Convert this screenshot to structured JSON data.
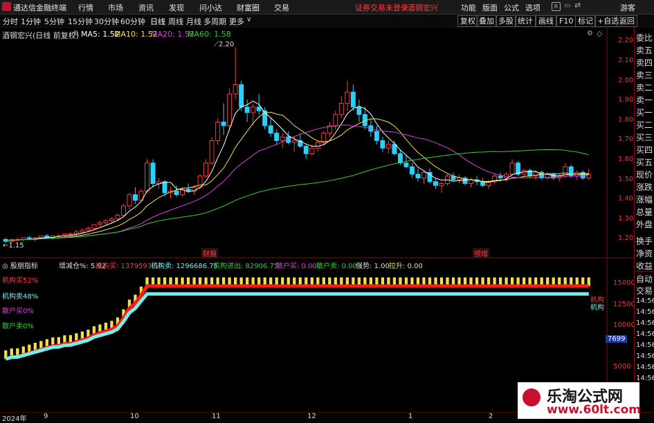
{
  "app": {
    "name": "通达信金融终端",
    "status_warning": "证券交易未登录",
    "stock_name": "酒钢宏兴",
    "guest": "游客"
  },
  "menu": [
    "行情",
    "市场",
    "资讯",
    "发现",
    "问小达",
    "财富圈",
    "交易"
  ],
  "right_menu": [
    "功能",
    "版面",
    "公式",
    "选项"
  ],
  "timeframes": [
    "分时",
    "1分钟",
    "5分钟",
    "15分钟",
    "30分钟",
    "60分钟",
    "日线",
    "周线",
    "月线",
    "多周期",
    "更多"
  ],
  "active_timeframe": "日线",
  "toolbar_right": [
    "复权",
    "叠加",
    "多股",
    "统计",
    "画线",
    "F10",
    "标记",
    "+自选",
    "返回"
  ],
  "chart_header": {
    "title": "酒钢宏兴(日线 前复权)",
    "ma5": "MA5: 1.52",
    "ma10": "MA10: 1.52",
    "ma20": "MA20: 1.52",
    "ma60": "MA60: 1.58"
  },
  "price_annotations": {
    "high": "2.20",
    "low": "1.15"
  },
  "event_labels": [
    "财报",
    "预增"
  ],
  "indicator_header": {
    "name": "股朋指标",
    "add": "增减仓%: 5.92",
    "inst_buy": "机构买: 1379593.50",
    "inst_sell": "机构卖: 1296686.75",
    "inst_net": "机构进出: 82906.75",
    "retail_buy": "散户买: 0.00",
    "retail_sell": "散户卖: 0.00",
    "strength": "强势: 1.00",
    "rise": "拉升: 0.00"
  },
  "indicator_legend": [
    "机构买52%",
    "机构卖48%",
    "散户买0%",
    "散户卖0%"
  ],
  "right_panel": [
    "委比",
    "卖五",
    "卖四",
    "卖三",
    "卖二",
    "卖一",
    "买一",
    "买二",
    "买三",
    "买四",
    "买五",
    "现价",
    "涨跌",
    "涨幅",
    "总量",
    "外盘",
    "换手",
    "净资",
    "收益",
    "自动",
    "交易"
  ],
  "time_ticks": [
    "14:56",
    "14:56",
    "14:56",
    "14:56",
    "14:56",
    "14:56",
    "14:56",
    "14:56"
  ],
  "price_axis": [
    "2.20",
    "2.10",
    "2.00",
    "1.90",
    "1.80",
    "1.70",
    "1.60",
    "1.50",
    "1.40",
    "1.30",
    "1.20"
  ],
  "indicator_axis": [
    "15000",
    "12500",
    "10000",
    "7699",
    "5000"
  ],
  "indicator_end_labels": [
    "机构",
    "机构"
  ],
  "x_axis": [
    "2024年",
    "9",
    "10",
    "11",
    "12",
    "1",
    "2"
  ],
  "watermark": {
    "line1": "乐淘公式网",
    "line2": "www.60lt.com"
  },
  "colors": {
    "up": "#ff3a3a",
    "down": "#29d0ff",
    "ma5": "#ffffff",
    "ma10": "#f5e04a",
    "ma20": "#d940d9",
    "ma60": "#2fd02f",
    "inst_buy": "#ff1a1a",
    "inst_sell": "#6ff0f0",
    "bars": "#f5e04a"
  },
  "chart_data": {
    "type": "candlestick",
    "ylim": [
      1.12,
      2.25
    ],
    "candles": [
      [
        1.17,
        1.18,
        1.15,
        1.16
      ],
      [
        1.16,
        1.17,
        1.15,
        1.17
      ],
      [
        1.17,
        1.18,
        1.16,
        1.17
      ],
      [
        1.17,
        1.18,
        1.16,
        1.18
      ],
      [
        1.18,
        1.19,
        1.17,
        1.17
      ],
      [
        1.17,
        1.18,
        1.16,
        1.18
      ],
      [
        1.18,
        1.19,
        1.17,
        1.19
      ],
      [
        1.19,
        1.2,
        1.18,
        1.18
      ],
      [
        1.18,
        1.19,
        1.17,
        1.19
      ],
      [
        1.19,
        1.2,
        1.18,
        1.19
      ],
      [
        1.19,
        1.2,
        1.18,
        1.2
      ],
      [
        1.2,
        1.21,
        1.19,
        1.2
      ],
      [
        1.2,
        1.22,
        1.19,
        1.21
      ],
      [
        1.21,
        1.23,
        1.2,
        1.22
      ],
      [
        1.22,
        1.24,
        1.21,
        1.23
      ],
      [
        1.23,
        1.25,
        1.22,
        1.25
      ],
      [
        1.25,
        1.27,
        1.24,
        1.26
      ],
      [
        1.26,
        1.28,
        1.25,
        1.27
      ],
      [
        1.27,
        1.29,
        1.26,
        1.28
      ],
      [
        1.28,
        1.31,
        1.27,
        1.3
      ],
      [
        1.3,
        1.36,
        1.29,
        1.35
      ],
      [
        1.35,
        1.42,
        1.33,
        1.41
      ],
      [
        1.41,
        1.45,
        1.36,
        1.38
      ],
      [
        1.38,
        1.44,
        1.37,
        1.43
      ],
      [
        1.43,
        1.6,
        1.42,
        1.58
      ],
      [
        1.58,
        1.6,
        1.45,
        1.47
      ],
      [
        1.47,
        1.5,
        1.44,
        1.48
      ],
      [
        1.48,
        1.49,
        1.4,
        1.42
      ],
      [
        1.42,
        1.45,
        1.39,
        1.43
      ],
      [
        1.43,
        1.46,
        1.4,
        1.41
      ],
      [
        1.41,
        1.45,
        1.4,
        1.44
      ],
      [
        1.44,
        1.47,
        1.42,
        1.43
      ],
      [
        1.43,
        1.46,
        1.41,
        1.45
      ],
      [
        1.45,
        1.52,
        1.44,
        1.51
      ],
      [
        1.51,
        1.6,
        1.5,
        1.58
      ],
      [
        1.58,
        1.72,
        1.57,
        1.7
      ],
      [
        1.7,
        1.82,
        1.68,
        1.8
      ],
      [
        1.8,
        1.9,
        1.73,
        1.78
      ],
      [
        1.78,
        1.98,
        1.75,
        1.95
      ],
      [
        1.95,
        2.2,
        1.92,
        2.0
      ],
      [
        2.0,
        2.02,
        1.86,
        1.88
      ],
      [
        1.88,
        1.92,
        1.8,
        1.85
      ],
      [
        1.85,
        1.9,
        1.78,
        1.88
      ],
      [
        1.88,
        1.95,
        1.84,
        1.86
      ],
      [
        1.86,
        1.88,
        1.76,
        1.78
      ],
      [
        1.78,
        1.82,
        1.72,
        1.74
      ],
      [
        1.74,
        1.76,
        1.68,
        1.7
      ],
      [
        1.7,
        1.74,
        1.66,
        1.72
      ],
      [
        1.72,
        1.75,
        1.68,
        1.69
      ],
      [
        1.69,
        1.72,
        1.64,
        1.7
      ],
      [
        1.7,
        1.74,
        1.66,
        1.67
      ],
      [
        1.67,
        1.68,
        1.6,
        1.63
      ],
      [
        1.63,
        1.68,
        1.62,
        1.66
      ],
      [
        1.66,
        1.7,
        1.64,
        1.69
      ],
      [
        1.69,
        1.75,
        1.68,
        1.74
      ],
      [
        1.74,
        1.8,
        1.72,
        1.78
      ],
      [
        1.78,
        1.86,
        1.76,
        1.84
      ],
      [
        1.84,
        1.94,
        1.82,
        1.9
      ],
      [
        1.9,
        2.02,
        1.86,
        1.96
      ],
      [
        1.96,
        2.0,
        1.86,
        1.88
      ],
      [
        1.88,
        1.92,
        1.8,
        1.84
      ],
      [
        1.84,
        1.88,
        1.76,
        1.78
      ],
      [
        1.78,
        1.82,
        1.72,
        1.75
      ],
      [
        1.75,
        1.78,
        1.68,
        1.7
      ],
      [
        1.7,
        1.72,
        1.64,
        1.66
      ],
      [
        1.66,
        1.7,
        1.63,
        1.68
      ],
      [
        1.68,
        1.7,
        1.62,
        1.63
      ],
      [
        1.63,
        1.65,
        1.57,
        1.58
      ],
      [
        1.58,
        1.62,
        1.55,
        1.56
      ],
      [
        1.56,
        1.58,
        1.5,
        1.52
      ],
      [
        1.52,
        1.55,
        1.48,
        1.5
      ],
      [
        1.5,
        1.54,
        1.47,
        1.53
      ],
      [
        1.53,
        1.55,
        1.47,
        1.48
      ],
      [
        1.48,
        1.5,
        1.44,
        1.46
      ],
      [
        1.46,
        1.48,
        1.42,
        1.47
      ],
      [
        1.47,
        1.52,
        1.46,
        1.51
      ],
      [
        1.51,
        1.53,
        1.48,
        1.49
      ],
      [
        1.49,
        1.52,
        1.47,
        1.5
      ],
      [
        1.5,
        1.51,
        1.46,
        1.47
      ],
      [
        1.47,
        1.5,
        1.45,
        1.49
      ],
      [
        1.49,
        1.51,
        1.46,
        1.48
      ],
      [
        1.48,
        1.5,
        1.45,
        1.46
      ],
      [
        1.46,
        1.49,
        1.44,
        1.48
      ],
      [
        1.48,
        1.52,
        1.47,
        1.51
      ],
      [
        1.51,
        1.53,
        1.49,
        1.5
      ],
      [
        1.5,
        1.53,
        1.48,
        1.52
      ],
      [
        1.52,
        1.6,
        1.51,
        1.58
      ],
      [
        1.58,
        1.59,
        1.51,
        1.52
      ],
      [
        1.52,
        1.55,
        1.5,
        1.54
      ],
      [
        1.54,
        1.55,
        1.5,
        1.51
      ],
      [
        1.51,
        1.54,
        1.49,
        1.53
      ],
      [
        1.53,
        1.54,
        1.49,
        1.5
      ],
      [
        1.5,
        1.53,
        1.49,
        1.52
      ],
      [
        1.52,
        1.53,
        1.49,
        1.5
      ],
      [
        1.5,
        1.52,
        1.48,
        1.51
      ],
      [
        1.51,
        1.58,
        1.5,
        1.56
      ],
      [
        1.56,
        1.57,
        1.5,
        1.51
      ],
      [
        1.51,
        1.54,
        1.49,
        1.53
      ],
      [
        1.53,
        1.54,
        1.49,
        1.5
      ],
      [
        1.5,
        1.55,
        1.49,
        1.52
      ]
    ],
    "ind_ylim": [
      3000,
      16500
    ],
    "inst_buy": [],
    "inst_sell": []
  }
}
